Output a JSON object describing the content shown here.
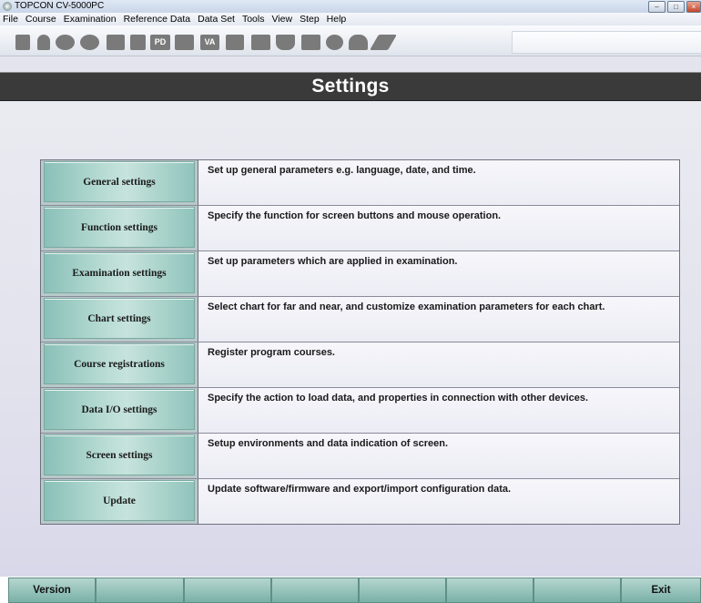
{
  "window": {
    "title": "TOPCON CV-5000PC",
    "controls": [
      "–",
      "□",
      "×"
    ]
  },
  "menu": [
    "File",
    "Course",
    "Examination",
    "Reference Data",
    "Data Set",
    "Tools",
    "View",
    "Step",
    "Help"
  ],
  "toolbar": {
    "pd_label": "PD",
    "va_label": "VA"
  },
  "header": {
    "title": "Settings"
  },
  "settings": [
    {
      "label": "General settings",
      "description": "Set up general parameters e.g. language, date, and time."
    },
    {
      "label": "Function settings",
      "description": "Specify the function for screen buttons and mouse operation."
    },
    {
      "label": "Examination settings",
      "description": "Set up parameters which are applied in examination."
    },
    {
      "label": "Chart settings",
      "description": "Select chart for far and near, and customize examination parameters for each chart."
    },
    {
      "label": "Course registrations",
      "description": "Register program courses."
    },
    {
      "label": "Data I/O settings",
      "description": "Specify the action to load data, and properties in connection with other devices."
    },
    {
      "label": "Screen settings",
      "description": "Setup environments and data indication of screen."
    },
    {
      "label": "Update",
      "description": "Update software/firmware and export/import configuration data."
    }
  ],
  "bottom": {
    "version_label": "Version",
    "exit_label": "Exit"
  }
}
